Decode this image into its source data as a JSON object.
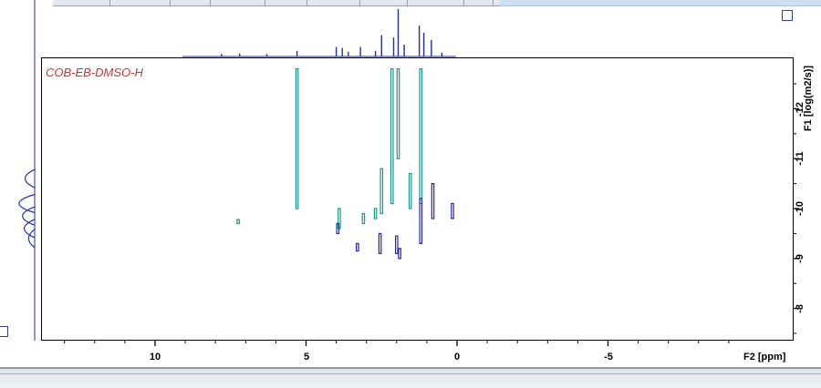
{
  "spectrum": {
    "title": "COB-EB-DMSO-H"
  },
  "axes": {
    "f2_label": "F2 [ppm]",
    "f1_label": "F1 [log(m2/s)]",
    "x_ticks": [
      "10",
      "5",
      "0",
      "-5"
    ],
    "y_ticks": [
      "-12",
      "-11",
      "-10",
      "-9",
      "-8"
    ]
  },
  "colors": {
    "contour_teal": "#139a8a",
    "contour_blue": "#1f23b8",
    "projection_blue": "#1d2fb5",
    "label_red": "#d23232"
  },
  "chart_data": {
    "type": "contour",
    "x_axis": {
      "label": "F2 [ppm]",
      "range": [
        14,
        -11
      ],
      "reversed": true
    },
    "y_axis": {
      "label": "F1 [log(m2/s)]",
      "range": [
        -12.8,
        -7.6
      ],
      "reversed": true
    },
    "series": [
      {
        "color": "#139a8a",
        "peaks": [
          {
            "x": 5.3,
            "y_top": -12.8,
            "y_bottom": -10.0
          },
          {
            "x": 2.15,
            "y_top": -12.8,
            "y_bottom": -10.1
          },
          {
            "x": 1.95,
            "y_top": -12.8,
            "y_bottom": -11.0
          },
          {
            "x": 1.2,
            "y_top": -12.8,
            "y_bottom": -10.1
          },
          {
            "x": 2.5,
            "y_top": -10.8,
            "y_bottom": -9.9
          },
          {
            "x": 3.9,
            "y_top": -10.0,
            "y_bottom": -9.6
          },
          {
            "x": 3.1,
            "y_top": -9.9,
            "y_bottom": -9.7
          },
          {
            "x": 2.7,
            "y_top": -10.0,
            "y_bottom": -9.8
          },
          {
            "x": 1.55,
            "y_top": -10.7,
            "y_bottom": -10.0
          },
          {
            "x": 7.25,
            "y_top": -9.78,
            "y_bottom": -9.7
          }
        ]
      },
      {
        "color": "#1f23b8",
        "peaks": [
          {
            "x": 1.2,
            "y_top": -10.2,
            "y_bottom": -9.3
          },
          {
            "x": 0.8,
            "y_top": -10.5,
            "y_bottom": -9.8
          },
          {
            "x": 0.15,
            "y_top": -10.1,
            "y_bottom": -9.8
          },
          {
            "x": 3.95,
            "y_top": -9.7,
            "y_bottom": -9.5
          },
          {
            "x": 2.55,
            "y_top": -9.5,
            "y_bottom": -9.1
          },
          {
            "x": 2.0,
            "y_top": -9.45,
            "y_bottom": -9.1
          },
          {
            "x": 3.3,
            "y_top": -9.3,
            "y_bottom": -9.15
          },
          {
            "x": 1.9,
            "y_top": -9.2,
            "y_bottom": -9.0
          }
        ]
      }
    ],
    "f2_projection_peaks": [
      {
        "x": 7.8,
        "h": 0.05
      },
      {
        "x": 7.2,
        "h": 0.06
      },
      {
        "x": 6.3,
        "h": 0.05
      },
      {
        "x": 5.3,
        "h": 0.12
      },
      {
        "x": 4.0,
        "h": 0.2
      },
      {
        "x": 3.8,
        "h": 0.18
      },
      {
        "x": 3.6,
        "h": 0.1
      },
      {
        "x": 3.2,
        "h": 0.2
      },
      {
        "x": 2.7,
        "h": 0.12
      },
      {
        "x": 2.5,
        "h": 0.45
      },
      {
        "x": 2.1,
        "h": 0.4
      },
      {
        "x": 1.95,
        "h": 1.0
      },
      {
        "x": 1.75,
        "h": 0.25
      },
      {
        "x": 1.25,
        "h": 0.65
      },
      {
        "x": 1.1,
        "h": 0.5
      },
      {
        "x": 0.85,
        "h": 0.35
      },
      {
        "x": 0.5,
        "h": 0.08
      }
    ],
    "f1_projection_peaks": [
      {
        "y": -10.6,
        "h": 0.55
      },
      {
        "y": -10.1,
        "h": 0.9
      },
      {
        "y": -9.85,
        "h": 0.7
      },
      {
        "y": -9.6,
        "h": 0.6
      },
      {
        "y": -9.4,
        "h": 0.35
      }
    ]
  }
}
